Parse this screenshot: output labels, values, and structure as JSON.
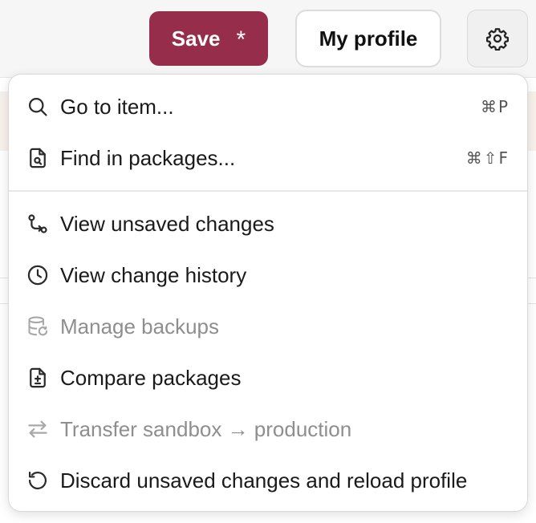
{
  "toolbar": {
    "save_label": "Save",
    "save_unsaved_marker": "*",
    "profile_label": "My profile",
    "settings_icon": "gear-icon"
  },
  "menu": {
    "items": [
      {
        "label": "Go to item...",
        "icon": "search-icon",
        "shortcut": "⌘P",
        "disabled": false
      },
      {
        "label": "Find in packages...",
        "icon": "file-search-icon",
        "shortcut": "⌘⇧F",
        "disabled": false
      },
      {
        "label": "View unsaved changes",
        "icon": "git-compare-icon",
        "shortcut": "",
        "disabled": false
      },
      {
        "label": "View change history",
        "icon": "clock-icon",
        "shortcut": "",
        "disabled": false
      },
      {
        "label": "Manage backups",
        "icon": "database-restore-icon",
        "shortcut": "",
        "disabled": true
      },
      {
        "label": "Compare packages",
        "icon": "file-diff-icon",
        "shortcut": "",
        "disabled": false
      },
      {
        "label": "Transfer sandbox → production",
        "icon": "arrows-swap-icon",
        "shortcut": "",
        "disabled": true
      },
      {
        "label": "Discard unsaved changes and reload profile",
        "icon": "rotate-ccw-icon",
        "shortcut": "",
        "disabled": false
      }
    ]
  },
  "colors": {
    "save_button": "#962d4a",
    "menu_background": "#ffffff",
    "disabled_text": "#8e8e8e"
  }
}
